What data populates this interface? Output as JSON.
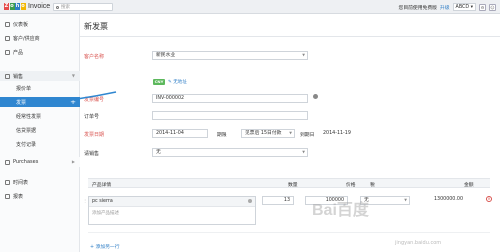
{
  "app": {
    "name": "Invoice",
    "logo_letters": [
      "Z",
      "o",
      "h",
      "o"
    ],
    "logo_colors": [
      "#e54b4b",
      "#3e9d4e",
      "#2e7ec6",
      "#f2b705"
    ]
  },
  "topbar": {
    "search_placeholder": "搜索",
    "trial_text": "您目前使用免费版",
    "upgrade_label": "升级",
    "org_label": "ABCD ▾",
    "icons": [
      "settings-icon",
      "user-icon"
    ]
  },
  "sidebar": {
    "items": [
      {
        "label": "仪表板",
        "icon": "dashboard-icon"
      },
      {
        "label": "客户/供应商",
        "icon": "contacts-icon"
      },
      {
        "label": "产品",
        "icon": "product-icon"
      }
    ],
    "sales_group": "销售",
    "sales_items": [
      "报价单",
      "发票",
      "经常性发票",
      "信贷票据",
      "支付记录"
    ],
    "active_item": "发票",
    "purchases": "Purchases",
    "bottom_items": [
      {
        "label": "时间表",
        "icon": "timesheet-icon"
      },
      {
        "label": "报表",
        "icon": "reports-icon"
      }
    ]
  },
  "form": {
    "page_title": "新发票",
    "customer_label": "客户名称",
    "customer_value": "新民水业",
    "currency_badge": "CNY",
    "no_address": "无地址",
    "invoice_no_label": "发票编号",
    "invoice_no_value": "INV-000002",
    "order_no_label": "订单号",
    "order_no_value": "",
    "date_label": "发票日期",
    "date_value": "2014-11-04",
    "terms_label": "期限",
    "terms_value": "见票后 15日付款",
    "due_label": "到期日",
    "due_value": "2014-11-19",
    "sales_label": "请销售",
    "sales_value": "无"
  },
  "items": {
    "headers": {
      "detail": "产品详情",
      "qty": "数量",
      "price": "价格",
      "tax": "税",
      "amount": "金额"
    },
    "rows": [
      {
        "name": "pc sierra",
        "desc_placeholder": "添加产品描述",
        "qty": "13",
        "price": "100000",
        "tax": "无",
        "amount": "1300000.00"
      }
    ],
    "add_row": "+ 添加另一行"
  },
  "watermark": "Bai百度",
  "watermark_sub": "jingyan.baidu.com"
}
